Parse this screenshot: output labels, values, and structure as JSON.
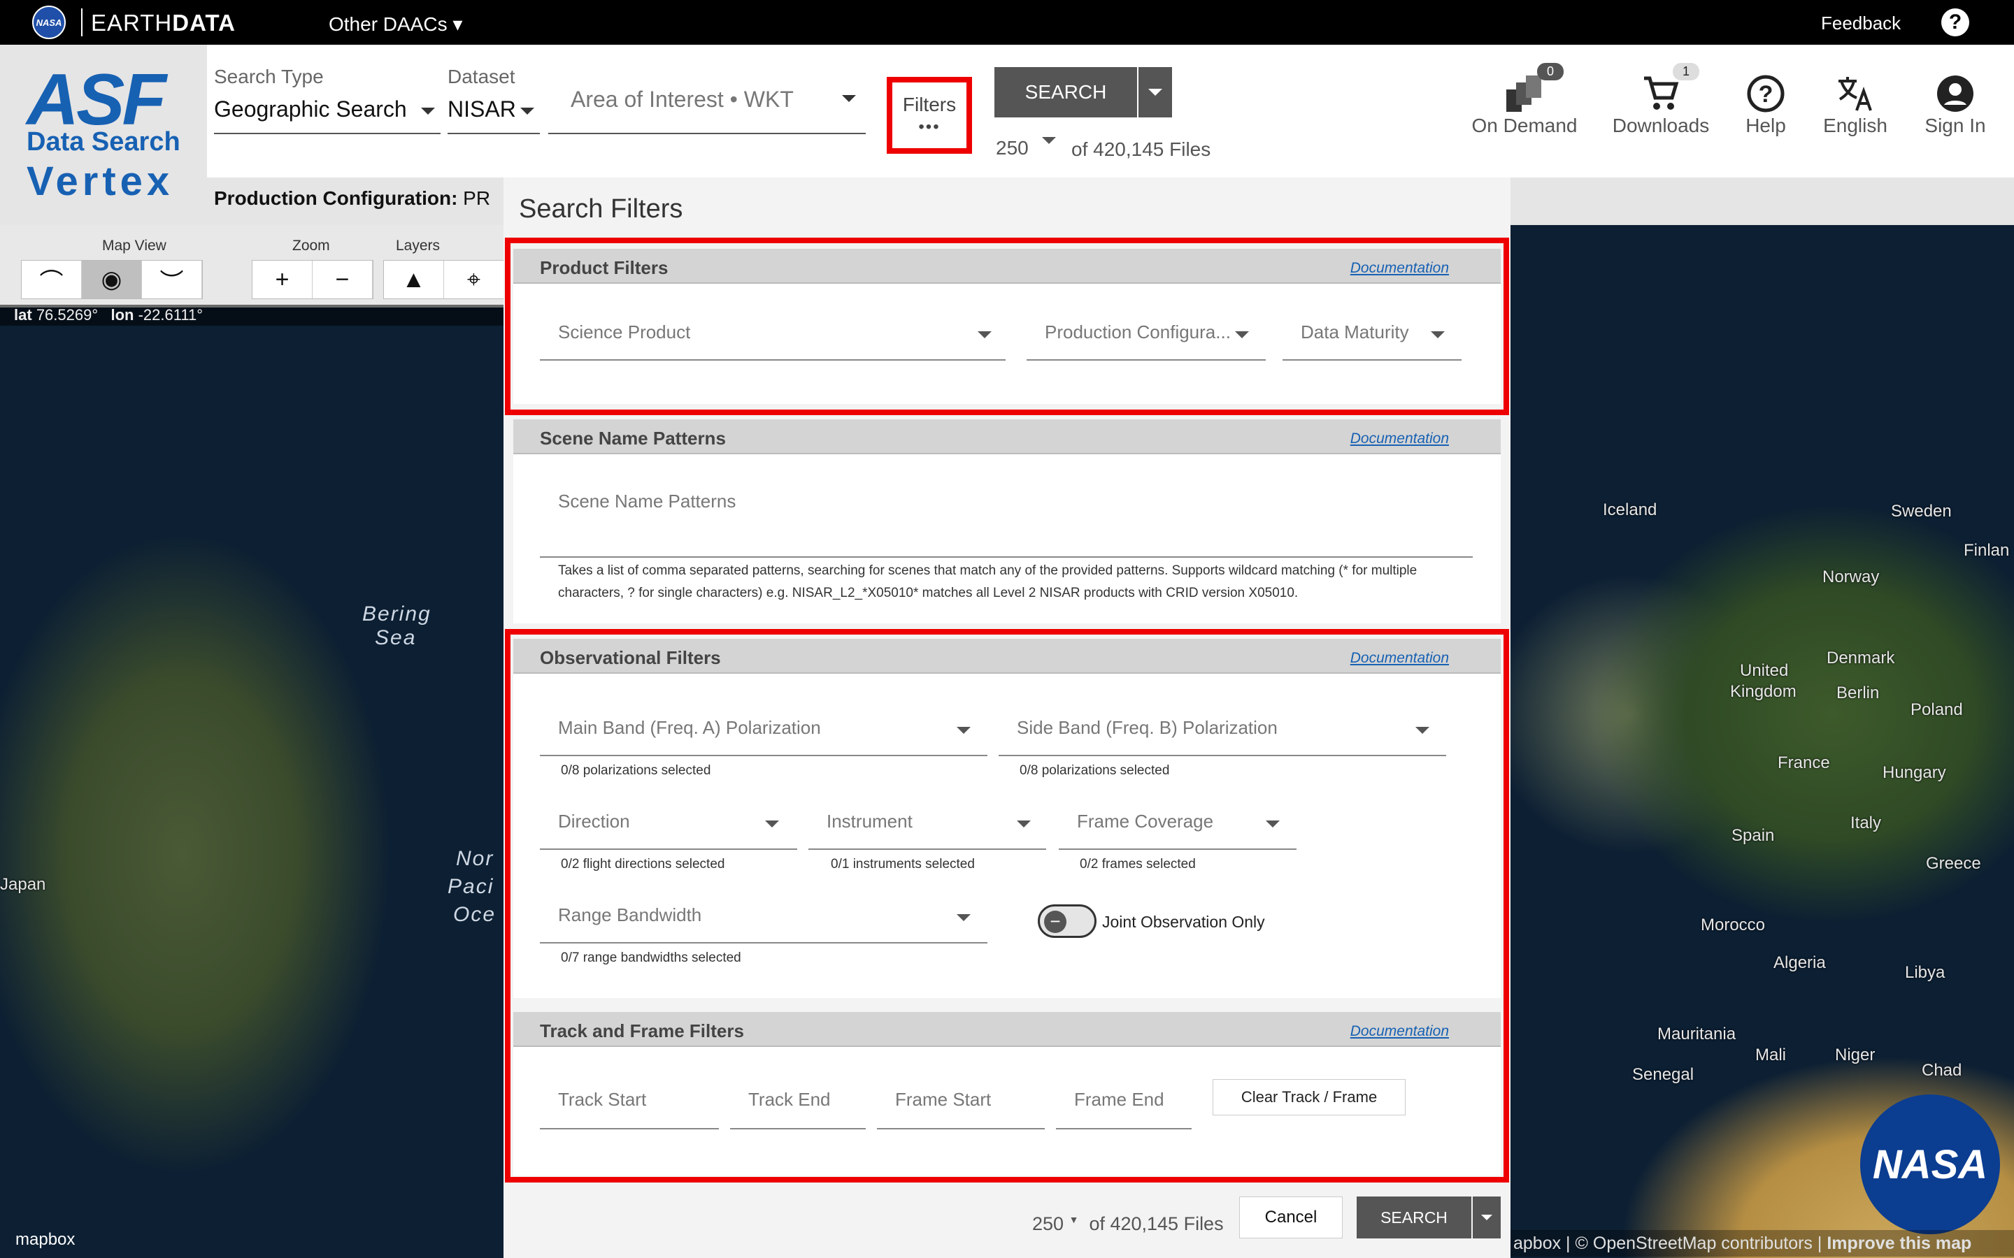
{
  "topbar": {
    "nasa": "NASA",
    "brand_light": "EARTH",
    "brand_bold": "DATA",
    "other_daacs": "Other DAACs ▾",
    "feedback": "Feedback",
    "help": "?"
  },
  "logo": {
    "asf": "ASF",
    "data_search": "Data Search",
    "vertex": "Vertex"
  },
  "header": {
    "search_type_label": "Search Type",
    "search_type_value": "Geographic Search",
    "dataset_label": "Dataset",
    "dataset_value": "NISAR",
    "aoi_placeholder": "Area of Interest • WKT",
    "filters_label": "Filters",
    "filters_dots": "•••",
    "search_label": "SEARCH",
    "max_results": "250",
    "files_count": "of 420,145 Files",
    "production_config_label": "Production Configuration:",
    "production_config_value": "PR"
  },
  "nav": [
    {
      "label": "On Demand",
      "icon": "on-demand-icon",
      "badge": "0"
    },
    {
      "label": "Downloads",
      "icon": "cart-icon",
      "badge": "1"
    },
    {
      "label": "Help",
      "icon": "help-circle-icon"
    },
    {
      "label": "English",
      "icon": "translate-icon"
    },
    {
      "label": "Sign In",
      "icon": "account-icon"
    }
  ],
  "map_controls": {
    "map_view": "Map View",
    "zoom": "Zoom",
    "layers": "Layers",
    "zoom_in": "+",
    "zoom_out": "−"
  },
  "coords": {
    "lat_label": "lat",
    "lat": "76.5269°",
    "lon_label": "lon",
    "lon": "-22.6111°"
  },
  "map_labels": {
    "bering": "Bering",
    "sea": "Sea",
    "japan": "Japan",
    "north": "Nor",
    "pacific": "Paci",
    "ocean": "Oce",
    "iceland": "Iceland",
    "norway": "Norway",
    "sweden": "Sweden",
    "finland": "Finlan",
    "uk1": "United",
    "uk2": "Kingdom",
    "denmark": "Denmark",
    "berlin": "Berlin",
    "poland": "Poland",
    "france": "France",
    "hungary": "Hungary",
    "spain": "Spain",
    "italy": "Italy",
    "greece": "Greece",
    "morocco": "Morocco",
    "algeria": "Algeria",
    "libya": "Libya",
    "mauritania": "Mauritania",
    "mali": "Mali",
    "niger": "Niger",
    "chad": "Chad",
    "senegal": "Senegal"
  },
  "attribution": {
    "mapbox": "mapbox",
    "osm": "apbox | © OpenStreetMap contributors |",
    "improve": "Improve this map",
    "nasa": "NASA"
  },
  "panel": {
    "title": "Search Filters",
    "doc": "Documentation",
    "product": {
      "title": "Product Filters",
      "science_product": "Science Product",
      "production_config": "Production Configura...",
      "data_maturity": "Data Maturity"
    },
    "scene": {
      "title": "Scene Name Patterns",
      "field": "Scene Name Patterns",
      "hint1": "Takes a list of comma separated patterns, searching for scenes that match any of the provided patterns. Supports wildcard matching (* for multiple",
      "hint2": "characters, ? for single characters) e.g. NISAR_L2_*X05010* matches all Level 2 NISAR products with CRID version X05010."
    },
    "obs": {
      "title": "Observational Filters",
      "main_band": "Main Band (Freq. A) Polarization",
      "main_band_hint": "0/8 polarizations selected",
      "side_band": "Side Band (Freq. B) Polarization",
      "side_band_hint": "0/8 polarizations selected",
      "direction": "Direction",
      "direction_hint": "0/2 flight directions selected",
      "instrument": "Instrument",
      "instrument_hint": "0/1 instruments selected",
      "frame_coverage": "Frame Coverage",
      "frame_coverage_hint": "0/2 frames selected",
      "range_bandwidth": "Range Bandwidth",
      "range_bandwidth_hint": "0/7 range bandwidths selected",
      "joint_toggle_glyph": "−",
      "joint": "Joint Observation Only"
    },
    "track": {
      "title": "Track and Frame Filters",
      "track_start": "Track Start",
      "track_end": "Track End",
      "frame_start": "Frame Start",
      "frame_end": "Frame End",
      "clear": "Clear Track / Frame"
    }
  },
  "footer": {
    "max": "250",
    "count": "of 420,145 Files",
    "cancel": "Cancel",
    "search": "SEARCH"
  },
  "colors": {
    "accent_red": "#ee0000",
    "brand_blue": "#1761b3",
    "button_gray": "#555555"
  }
}
